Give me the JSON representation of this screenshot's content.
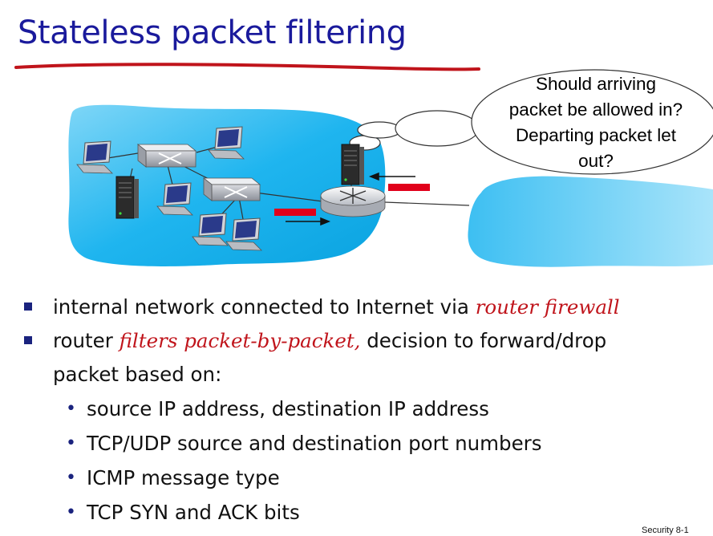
{
  "title": "Stateless packet filtering",
  "bubble": {
    "lines": [
      "Should arriving",
      "packet be allowed in?",
      "Departing packet let",
      "out?"
    ]
  },
  "bullets": [
    {
      "plain": "internal network connected to Internet via ",
      "emph": "router firewall",
      "after": ""
    },
    {
      "plain": "router ",
      "emph": "filters packet-by-packet,",
      "after": " decision to forward/drop",
      "cont": "packet based on:"
    }
  ],
  "sub_bullets": [
    "source IP address, destination IP address",
    "TCP/UDP source and destination port numbers",
    "ICMP message type",
    "TCP SYN and ACK bits"
  ],
  "footer": "Security 8-1",
  "colors": {
    "title": "#1a1a9c",
    "underline": "#c0141b",
    "emphasis": "#c0141b",
    "network": "#13b3ef",
    "packet": "#e1001a"
  }
}
